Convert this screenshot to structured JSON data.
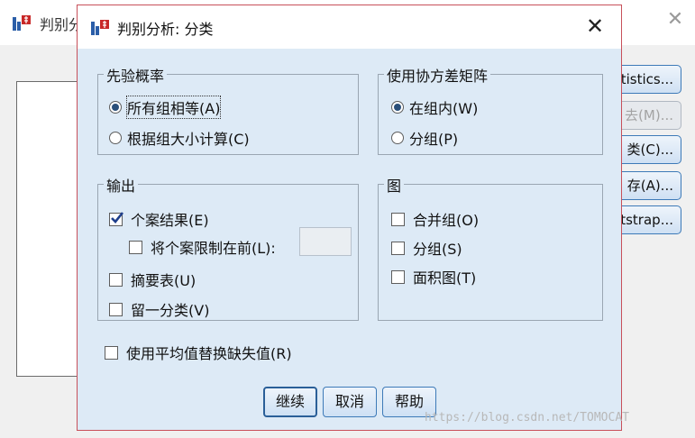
{
  "parent_window": {
    "title": "判别分",
    "side_buttons": [
      {
        "label": "tistics...",
        "disabled": false
      },
      {
        "label": "去(M)...",
        "disabled": true
      },
      {
        "label": "类(C)...",
        "disabled": false
      },
      {
        "label": "存(A)...",
        "disabled": false
      },
      {
        "label": "tstrap...",
        "disabled": false
      }
    ]
  },
  "dialog": {
    "title": "判别分析: 分类",
    "prior": {
      "legend": "先验概率",
      "options": [
        {
          "label": "所有组相等(A)",
          "selected": true
        },
        {
          "label": "根据组大小计算(C)",
          "selected": false
        }
      ]
    },
    "covariance": {
      "legend": "使用协方差矩阵",
      "options": [
        {
          "label": "在组内(W)",
          "selected": true
        },
        {
          "label": "分组(P)",
          "selected": false
        }
      ]
    },
    "output": {
      "legend": "输出",
      "casewise": {
        "label": "个案结果(E)",
        "checked": true
      },
      "limit": {
        "label": "将个案限制在前(L):",
        "checked": false,
        "value": ""
      },
      "summary": {
        "label": "摘要表(U)",
        "checked": false
      },
      "loo": {
        "label": "留一分类(V)",
        "checked": false
      }
    },
    "plots": {
      "legend": "图",
      "combined": {
        "label": "合并组(O)",
        "checked": false
      },
      "separate": {
        "label": "分组(S)",
        "checked": false
      },
      "territorial": {
        "label": "面积图(T)",
        "checked": false
      }
    },
    "replace_missing": {
      "label": "使用平均值替换缺失值(R)",
      "checked": false
    },
    "buttons": {
      "continue": "继续",
      "cancel": "取消",
      "help": "帮助"
    }
  },
  "watermark": "https://blog.csdn.net/TOMOCAT"
}
